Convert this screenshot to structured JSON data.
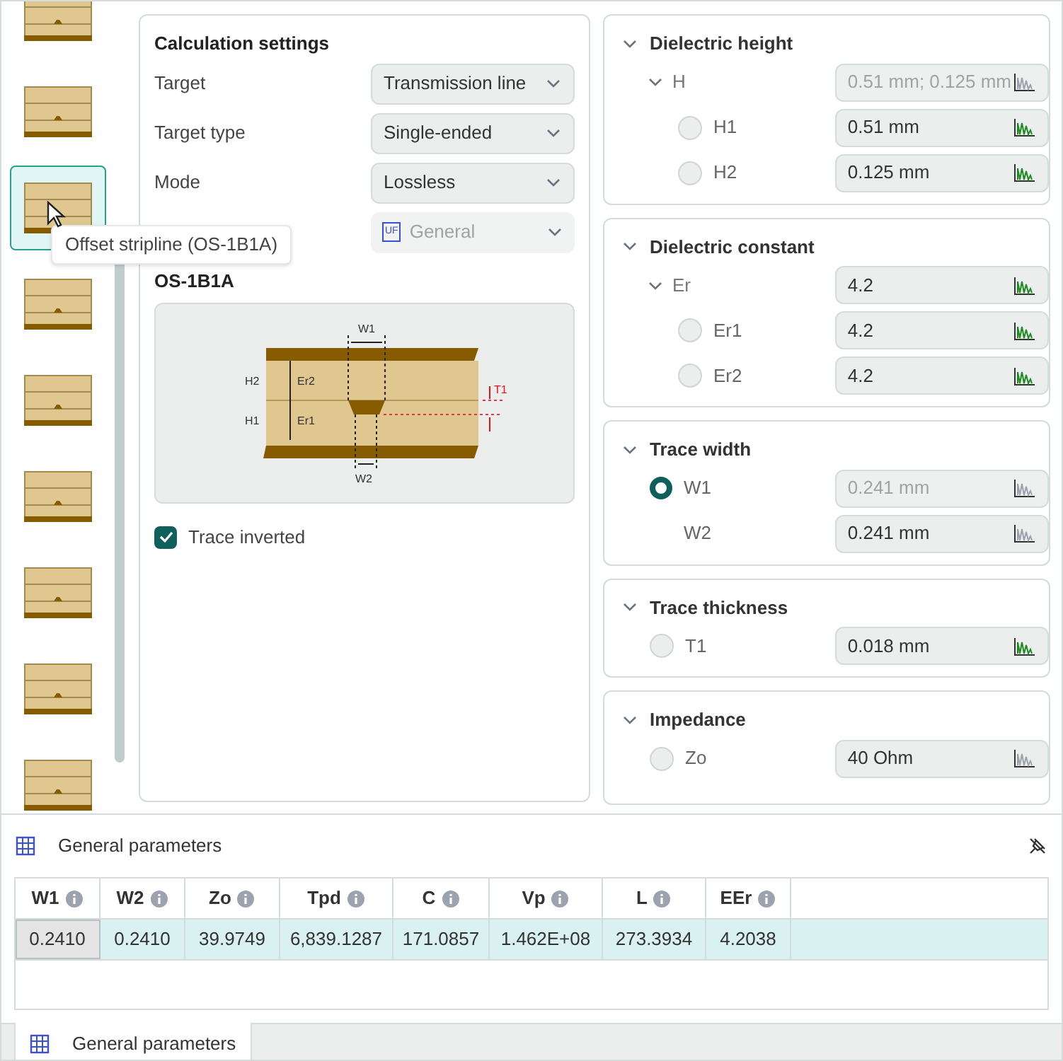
{
  "sidebar": {
    "items": [
      {
        "selected": false
      },
      {
        "selected": false
      },
      {
        "selected": true
      },
      {
        "selected": false
      },
      {
        "selected": false
      },
      {
        "selected": false
      },
      {
        "selected": false
      },
      {
        "selected": false
      },
      {
        "selected": false
      }
    ],
    "tooltip": "Offset stripline (OS-1B1A)"
  },
  "settings": {
    "title": "Calculation settings",
    "fields": [
      {
        "label": "Target",
        "value": "Transmission line",
        "disabled": false
      },
      {
        "label": "Target type",
        "value": "Single-ended",
        "disabled": false
      },
      {
        "label": "Mode",
        "value": "Lossless",
        "disabled": false
      },
      {
        "badge": "UF",
        "value": "General",
        "disabled": true
      }
    ],
    "diagram": {
      "title": "OS-1B1A",
      "labels": {
        "w1": "W1",
        "h2": "H2",
        "er2": "Er2",
        "t1": "T1",
        "h1": "H1",
        "er1": "Er1",
        "w2": "W2"
      }
    },
    "checkbox": {
      "label": "Trace inverted",
      "checked": true
    }
  },
  "sections": [
    {
      "title": "Dielectric height",
      "rows": [
        {
          "kind": "group",
          "label": "H",
          "value": "0.51 mm; 0.125 mm",
          "value_disabled": true,
          "chart_active": false
        },
        {
          "kind": "radio",
          "label": "H1",
          "value": "0.51 mm",
          "selected": false,
          "value_disabled": false,
          "chart_active": true
        },
        {
          "kind": "radio",
          "label": "H2",
          "value": "0.125 mm",
          "selected": false,
          "value_disabled": false,
          "chart_active": true
        }
      ]
    },
    {
      "title": "Dielectric constant",
      "rows": [
        {
          "kind": "group",
          "label": "Er",
          "value": "4.2",
          "value_disabled": false,
          "chart_active": true
        },
        {
          "kind": "radio",
          "label": "Er1",
          "value": "4.2",
          "selected": false,
          "value_disabled": false,
          "chart_active": true
        },
        {
          "kind": "radio",
          "label": "Er2",
          "value": "4.2",
          "selected": false,
          "value_disabled": false,
          "chart_active": true
        }
      ]
    },
    {
      "title": "Trace width",
      "rows": [
        {
          "kind": "radio",
          "label": "W1",
          "value": "0.241 mm",
          "selected": true,
          "value_disabled": true,
          "chart_active": false
        },
        {
          "kind": "plain",
          "label": "W2",
          "value": "0.241 mm",
          "value_disabled": false,
          "chart_active": false
        }
      ]
    },
    {
      "title": "Trace thickness",
      "rows": [
        {
          "kind": "radio",
          "label": "T1",
          "value": "0.018 mm",
          "selected": false,
          "value_disabled": false,
          "chart_active": true
        }
      ]
    },
    {
      "title": "Impedance",
      "rows": [
        {
          "kind": "radio",
          "label": "Zo",
          "value": "40 Ohm",
          "selected": false,
          "value_disabled": false,
          "chart_active": false
        }
      ]
    }
  ],
  "results": {
    "title": "General parameters",
    "columns": [
      "W1",
      "W2",
      "Zo",
      "Tpd",
      "C",
      "Vp",
      "L",
      "EEr"
    ],
    "rows": [
      {
        "selected": true,
        "cells": [
          {
            "value": "0.2410",
            "selected": true
          },
          {
            "value": "0.2410",
            "selected": false
          },
          {
            "value": "39.9749",
            "selected": false
          },
          {
            "value": "6,839.1287",
            "selected": false
          },
          {
            "value": "171.0857",
            "selected": false
          },
          {
            "value": "1.462E+08",
            "selected": false
          },
          {
            "value": "273.3934",
            "selected": false
          },
          {
            "value": "4.2038",
            "selected": false
          }
        ]
      }
    ]
  },
  "bottom_tabs": [
    {
      "label": "General parameters",
      "selected": true
    }
  ]
}
